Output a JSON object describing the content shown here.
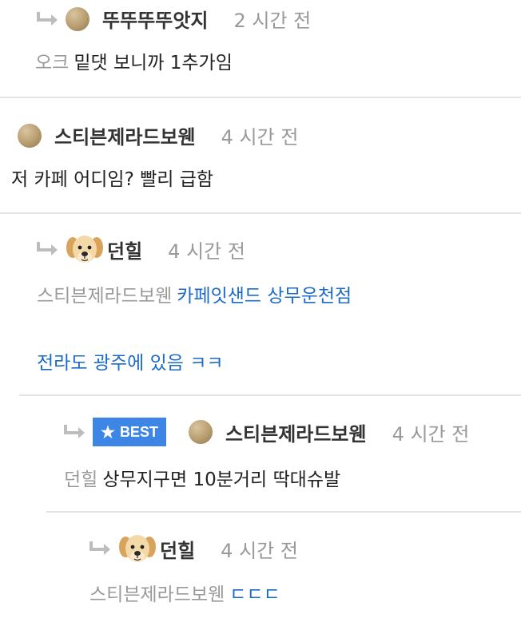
{
  "comments": [
    {
      "nickname": "뚜뚜뚜뚜앗지",
      "time": "2 시간 전",
      "mention": "오크",
      "text": "밑댓 보니까 1추가임"
    },
    {
      "nickname": "스티븐제라드보웬",
      "time": "4 시간 전",
      "text": "저 카페 어디임? 빨리 급함"
    },
    {
      "nickname": "던힐",
      "time": "4 시간 전",
      "mention": "스티븐제라드보웬",
      "text": "카페잇샌드 상무운천점",
      "text2": "전라도 광주에 있음 ㅋㅋ"
    },
    {
      "badge": "BEST",
      "nickname": "스티븐제라드보웬",
      "time": "4 시간 전",
      "mention": "던힐",
      "text": "상무지구면 10분거리 딱대슈발"
    },
    {
      "nickname": "던힐",
      "time": "4 시간 전",
      "mention": "스티븐제라드보웬",
      "text": "ㄷㄷㄷ"
    }
  ],
  "colors": {
    "link": "#1c6bc7",
    "badge": "#3e86e6",
    "muted": "#999999"
  },
  "icons": {
    "reply": "reply-arrow-icon",
    "avatar_default": "avatar-circle",
    "avatar_dog": "puppy-avatar",
    "best": "star-icon"
  }
}
